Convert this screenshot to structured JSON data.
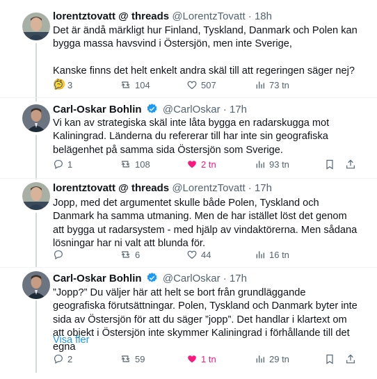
{
  "tweets": [
    {
      "name": "lorentztovatt @ threads",
      "handle": "@LorentzTovatt",
      "dot": "·",
      "time": "18h",
      "verified": false,
      "text": "Det är ändå märkligt hur Finland, Tyskland, Danmark och Polen kan bygga massa havsvind i Östersjön, men inte Sverige,\n\nKanske finns det helt enkelt andra skäl till att regeringen säger nej? 🤔",
      "replies": "3",
      "retweets": "104",
      "likes": "507",
      "views": "73 tn",
      "liked": false
    },
    {
      "name": "Carl-Oskar Bohlin",
      "handle": "@CarlOskar",
      "dot": "·",
      "time": "17h",
      "verified": true,
      "text": "Vi kan av strategiska skäl inte låta bygga en radarskugga mot Kaliningrad. Länderna du refererar till har inte sin geografiska belägenhet på samma sida Östersjön som Sverige.",
      "replies": "1",
      "retweets": "108",
      "likes": "2 tn",
      "views": "93 tn",
      "liked": true
    },
    {
      "name": "lorentztovatt @ threads",
      "handle": "@LorentzTovatt",
      "dot": "·",
      "time": "17h",
      "verified": false,
      "text": "Jopp, med det argumentet skulle både Polen, Tyskland och Danmark ha samma utmaning. Men de har istället löst det genom att bygga ut radarsystem - med hjälp av vindaktörerna. Men sådana lösningar har ni valt att blunda för.",
      "replies": "",
      "retweets": "6",
      "likes": "44",
      "views": "16 tn",
      "liked": false
    },
    {
      "name": "Carl-Oskar Bohlin",
      "handle": "@CarlOskar",
      "dot": "·",
      "time": "17h",
      "verified": true,
      "text": "”Jopp?” Du väljer här att helt se bort från grundläggande geografiska förutsättningar. Polen, Tyskland och Danmark byter inte sida av Östersjön för att du säger ”jopp”. Det handlar i klartext om att objekt i Östersjön inte skymmer Kaliningrad i förhållande till det egna",
      "show_more": "Visa fler",
      "replies": "2",
      "retweets": "59",
      "likes": "1 tn",
      "views": "29 tn",
      "liked": true
    }
  ],
  "colors": {
    "text": "#0f1419",
    "secondary": "#536471",
    "like": "#f91880",
    "link": "#1d9bf0",
    "verified": "#1d9bf0",
    "thread_line": "#cfd9de"
  },
  "icons": [
    "reply-icon",
    "retweet-icon",
    "like-icon",
    "views-icon",
    "bookmark-icon",
    "share-icon",
    "verified-badge-icon",
    "more-icon"
  ]
}
